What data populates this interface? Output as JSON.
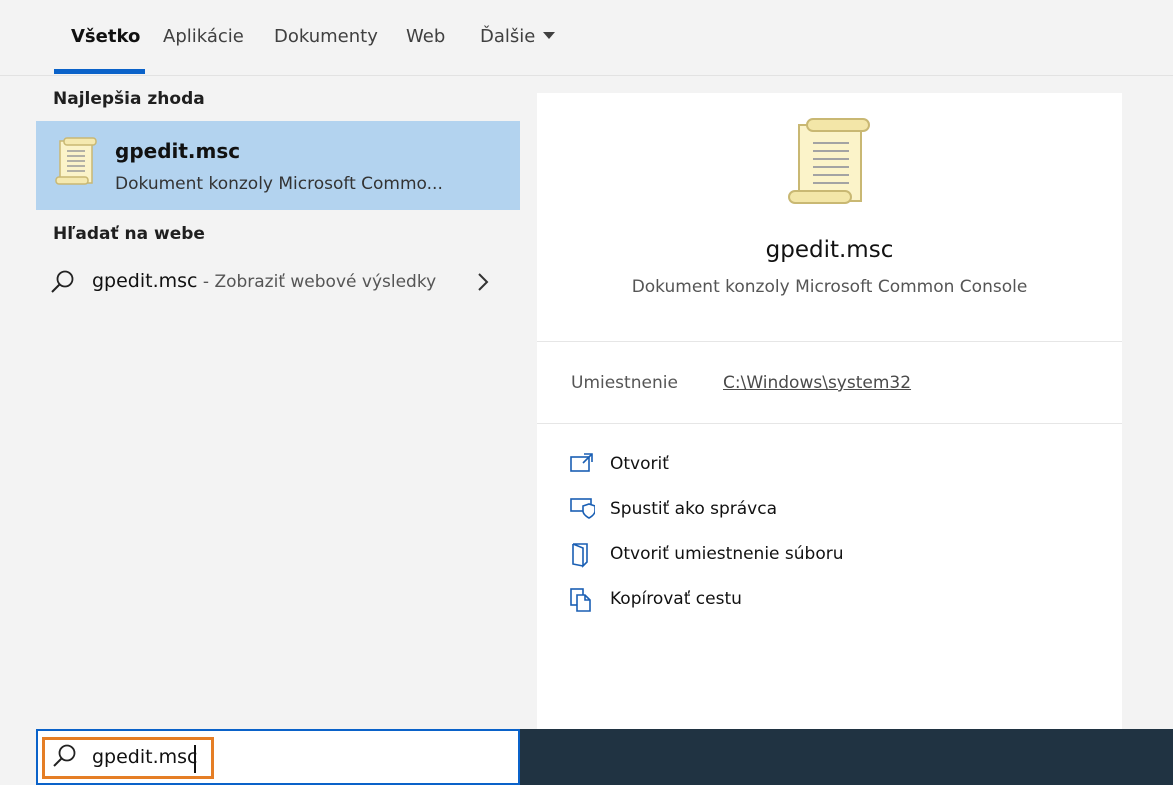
{
  "tabs": [
    {
      "label": "Všetko"
    },
    {
      "label": "Aplikácie"
    },
    {
      "label": "Dokumenty"
    },
    {
      "label": "Web"
    },
    {
      "label": "Ďalšie"
    }
  ],
  "results": {
    "best_match_heading": "Najlepšia zhoda",
    "best_match": {
      "title": "gpedit.msc",
      "subtitle": "Dokument konzoly Microsoft Commo..."
    },
    "web_heading": "Hľadať na webe",
    "web_item": {
      "query": "gpedit.msc",
      "suffix": " - Zobraziť webové výsledky"
    }
  },
  "preview": {
    "title": "gpedit.msc",
    "subtitle": "Dokument konzoly Microsoft Common Console",
    "location_label": "Umiestnenie",
    "location_path": "C:\\Windows\\system32",
    "actions": [
      {
        "label": "Otvoriť",
        "icon": "open-icon"
      },
      {
        "label": "Spustiť ako správca",
        "icon": "run-as-admin-icon"
      },
      {
        "label": "Otvoriť umiestnenie súboru",
        "icon": "open-file-location-icon"
      },
      {
        "label": "Kopírovať cestu",
        "icon": "copy-path-icon"
      }
    ]
  },
  "search": {
    "value": "gpedit.msc"
  },
  "colors": {
    "accent": "#0a62c9",
    "selection": "#b3d3ef",
    "highlight_border": "#e57e25",
    "taskbar": "#203342"
  }
}
